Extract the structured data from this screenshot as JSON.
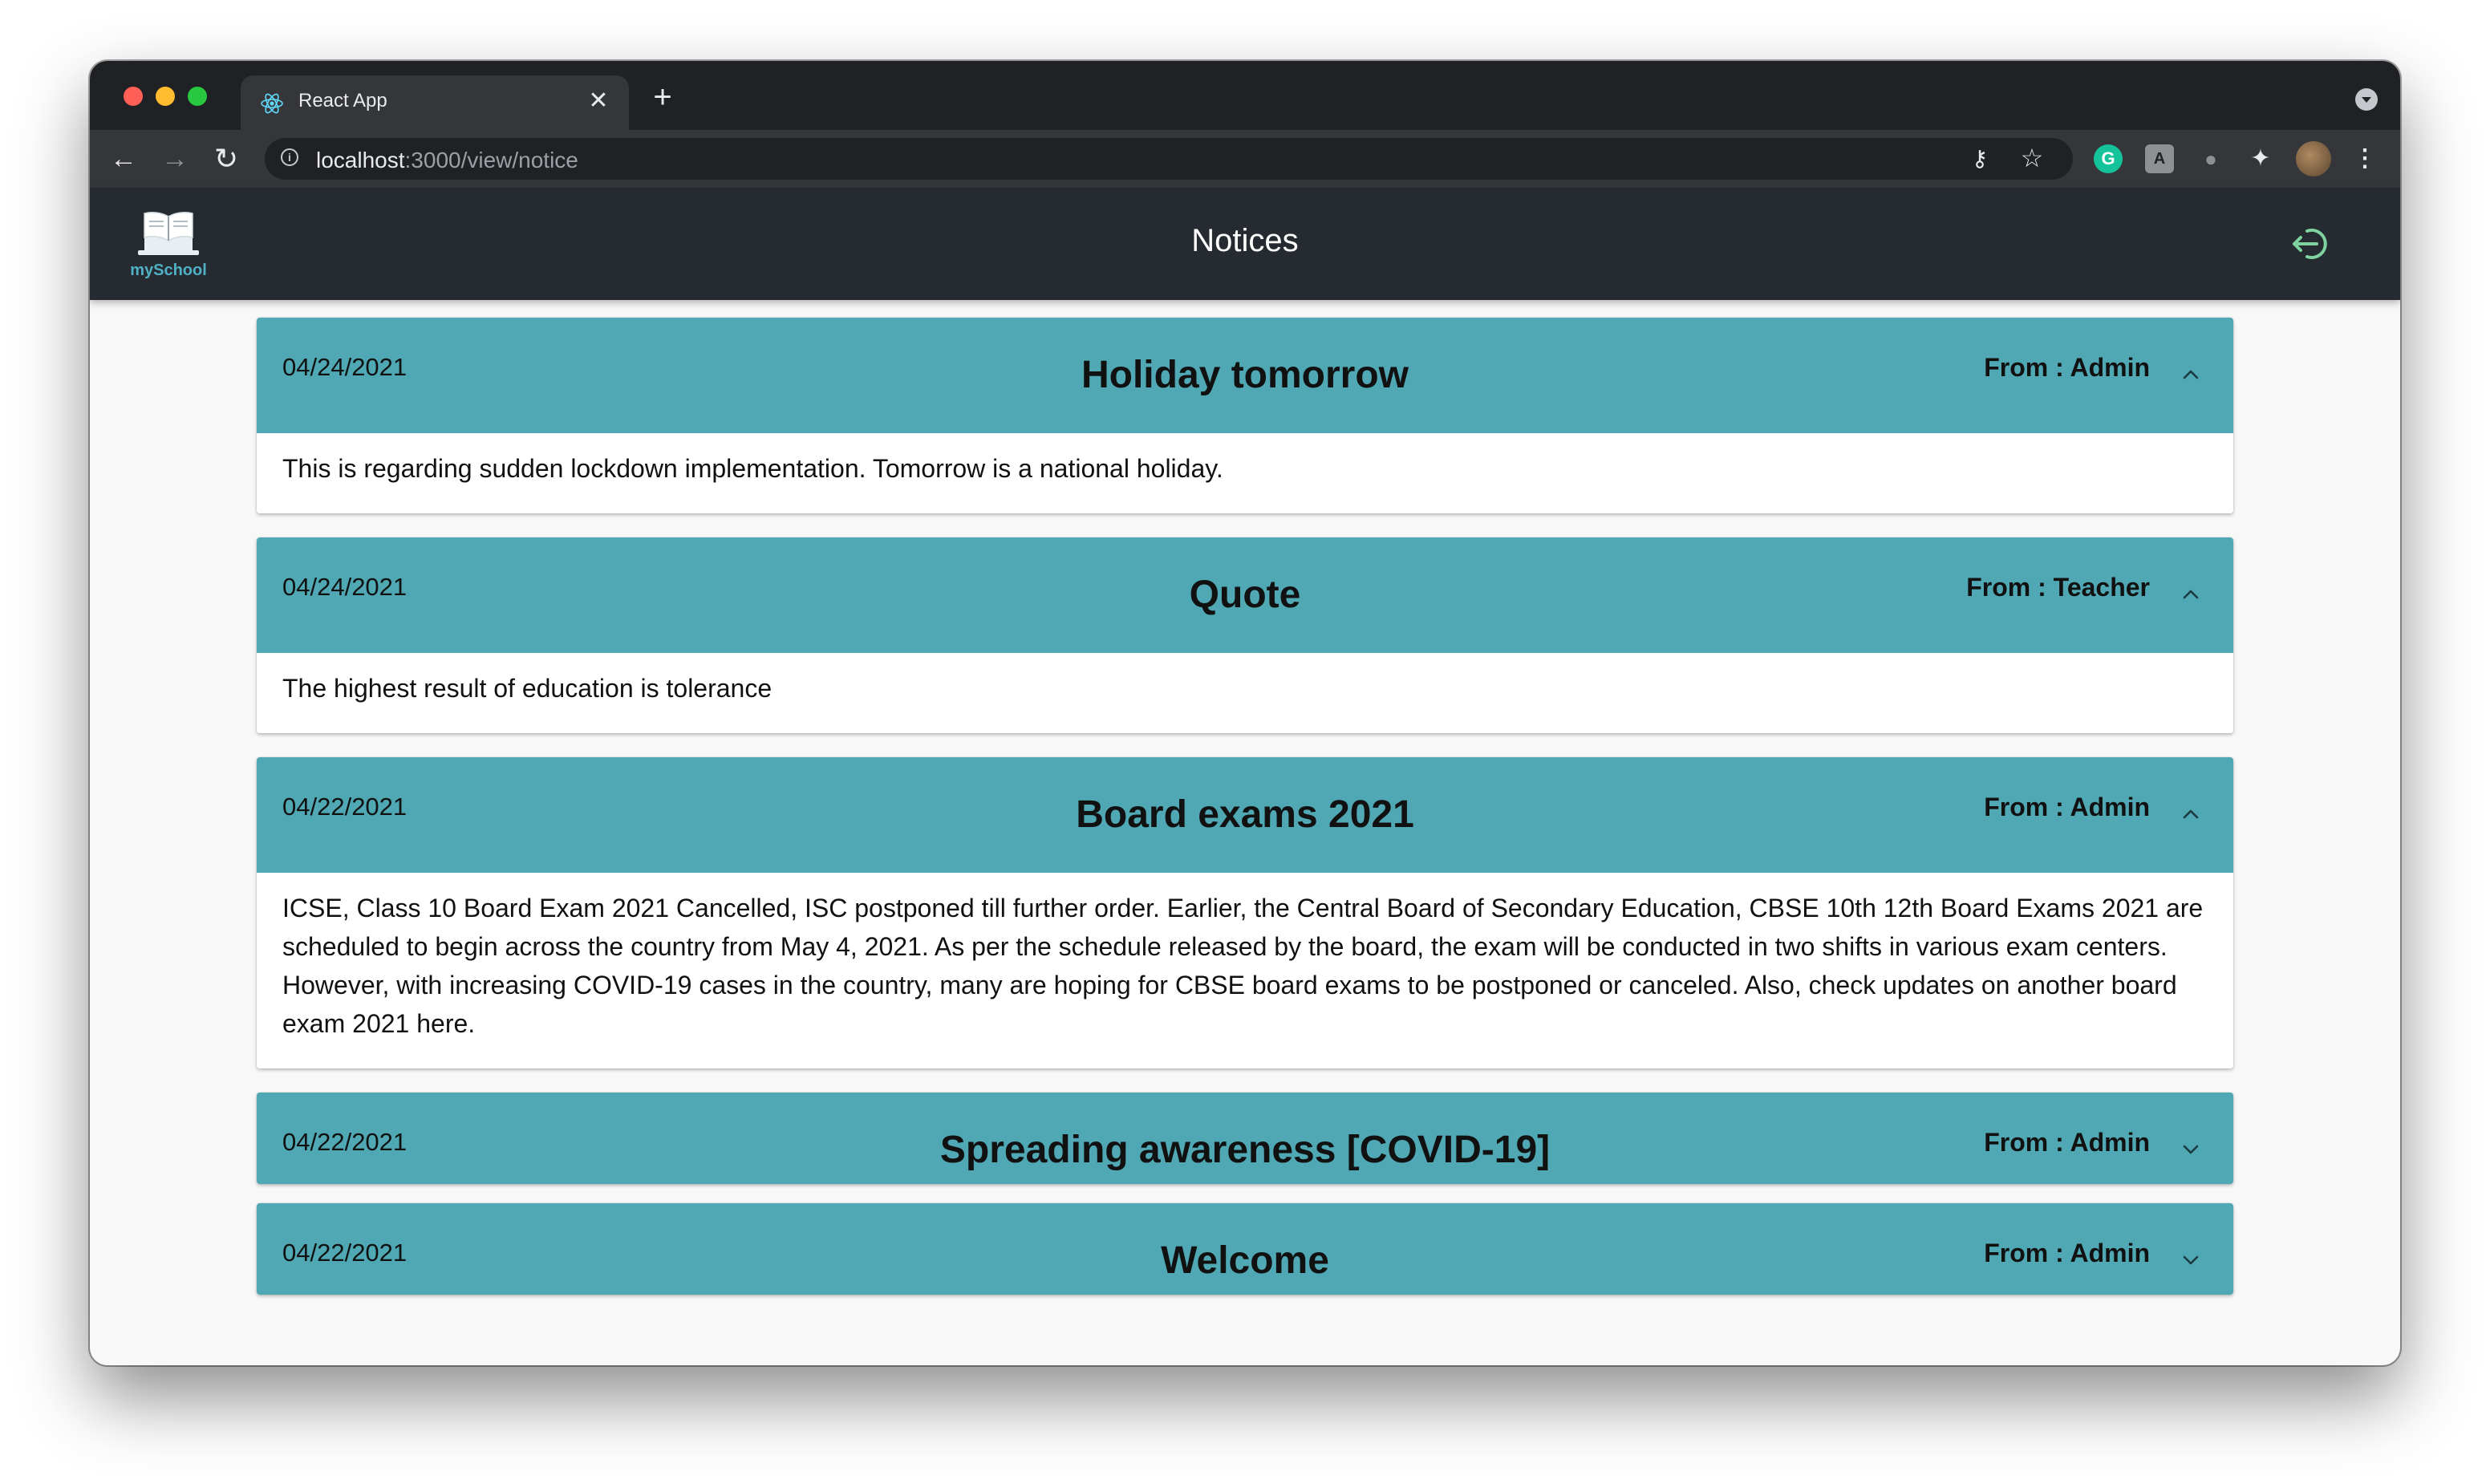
{
  "browser": {
    "tab_title": "React App",
    "url_host": "localhost",
    "url_rest": ":3000/view/notice"
  },
  "app": {
    "logo_text": "mySchool",
    "page_title": "Notices"
  },
  "notices": [
    {
      "date": "04/24/2021",
      "title": "Holiday tomorrow",
      "from": "From : Admin",
      "body": "This is regarding sudden lockdown implementation. Tomorrow is a national holiday.",
      "expanded": true
    },
    {
      "date": "04/24/2021",
      "title": "Quote",
      "from": "From : Teacher",
      "body": "The highest result of education is tolerance",
      "expanded": true
    },
    {
      "date": "04/22/2021",
      "title": "Board exams 2021",
      "from": "From : Admin",
      "body": "ICSE, Class 10 Board Exam 2021 Cancelled, ISC postponed till further order. Earlier, the Central Board of Secondary Education, CBSE 10th 12th Board Exams 2021 are scheduled to begin across the country from May 4, 2021. As per the schedule released by the board, the exam will be conducted in two shifts in various exam centers. However, with increasing COVID-19 cases in the country, many are hoping for CBSE board exams to be postponed or canceled. Also, check updates on another board exam 2021 here.",
      "expanded": true
    },
    {
      "date": "04/22/2021",
      "title": "Spreading awareness [COVID-19]",
      "from": "From : Admin",
      "expanded": false
    },
    {
      "date": "04/22/2021",
      "title": "Welcome",
      "from": "From : Admin",
      "expanded": false
    }
  ],
  "colors": {
    "accent": "#4fa8b3",
    "appbar": "#262b31",
    "logout_icon": "#7fd3a0"
  }
}
